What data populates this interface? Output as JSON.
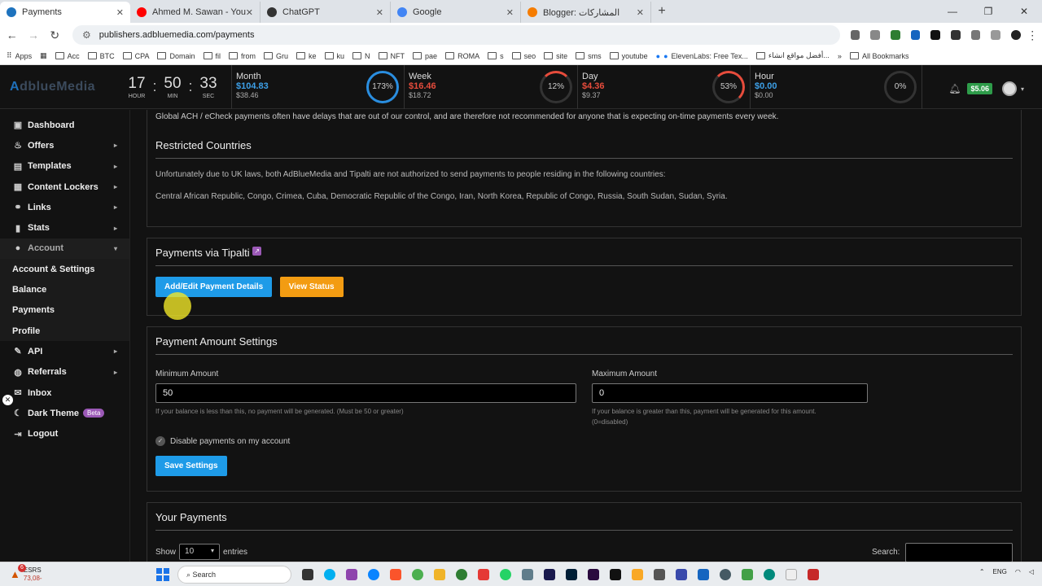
{
  "browser": {
    "tabs": [
      {
        "title": "Payments",
        "color": "#1e73be",
        "active": true
      },
      {
        "title": "Ahmed M. Sawan - YouTube",
        "color": "#ff0000",
        "active": false
      },
      {
        "title": "ChatGPT",
        "color": "#333333",
        "active": false
      },
      {
        "title": "Google",
        "color": "#4285f4",
        "active": false
      },
      {
        "title": "Blogger: المشاركات",
        "color": "#f57c00",
        "active": false
      }
    ],
    "new_tab": "+",
    "url": "publishers.adbluemedia.com/payments",
    "bookmarks": [
      "Apps",
      "Acc",
      "BTC",
      "CPA",
      "Domain",
      "fil",
      "from",
      "Gru",
      "ke",
      "ku",
      "N",
      "NFT",
      "pae",
      "ROMA",
      "s",
      "seo",
      "site",
      "sms",
      "youtube",
      "ElevenLabs: Free Tex...",
      "أفضل مواقع انشاء...",
      "All Bookmarks"
    ]
  },
  "header": {
    "logo_prefix": "A",
    "logo_rest": "dblueMedia",
    "timer": [
      {
        "value": "17",
        "label": "HOUR"
      },
      {
        "value": "50",
        "label": "MIN"
      },
      {
        "value": "33",
        "label": "SEC"
      }
    ],
    "timer_sep": ":",
    "stats": [
      {
        "title": "Month",
        "value": "$104.83",
        "prev": "$38.46",
        "percent": "173%",
        "value_color": "#3da0e8",
        "ring_color": "#2a8ee0"
      },
      {
        "title": "Week",
        "value": "$16.46",
        "prev": "$18.72",
        "percent": "12%",
        "value_color": "#e74c3c",
        "ring_color": "#e74c3c"
      },
      {
        "title": "Day",
        "value": "$4.36",
        "prev": "$9.37",
        "percent": "53%",
        "value_color": "#e74c3c",
        "ring_color": "#e74c3c"
      },
      {
        "title": "Hour",
        "value": "$0.00",
        "prev": "$0.00",
        "percent": "0%",
        "value_color": "#3da0e8",
        "ring_color": "#333333"
      }
    ],
    "balance": "$5.06"
  },
  "sidebar": {
    "items": [
      {
        "label": "Dashboard",
        "icon": "dashboard-icon",
        "glyph": "▣",
        "arrow": ""
      },
      {
        "label": "Offers",
        "icon": "fire-icon",
        "glyph": "♨",
        "arrow": "▸"
      },
      {
        "label": "Templates",
        "icon": "template-icon",
        "glyph": "▤",
        "arrow": "▸"
      },
      {
        "label": "Content Lockers",
        "icon": "locker-icon",
        "glyph": "▦",
        "arrow": "▸"
      },
      {
        "label": "Links",
        "icon": "link-icon",
        "glyph": "⚭",
        "arrow": "▸"
      },
      {
        "label": "Stats",
        "icon": "stats-icon",
        "glyph": "▮",
        "arrow": "▸"
      }
    ],
    "account": {
      "label": "Account",
      "glyph": "●",
      "arrow": "▾"
    },
    "sub_items": [
      "Account & Settings",
      "Balance",
      "Payments",
      "Profile"
    ],
    "bottom": [
      {
        "label": "API",
        "icon": "wrench-icon",
        "glyph": "✎",
        "arrow": "▸"
      },
      {
        "label": "Referrals",
        "icon": "globe-icon",
        "glyph": "◍",
        "arrow": "▸"
      },
      {
        "label": "Inbox",
        "icon": "mail-icon",
        "glyph": "✉",
        "arrow": ""
      }
    ],
    "dark_theme": "Dark Theme",
    "beta": "Beta",
    "logout": "Logout"
  },
  "main": {
    "ach_note": "Global ACH / eCheck payments often have delays that are out of our control, and are therefore not recommended for anyone that is expecting on-time payments every week.",
    "restricted": {
      "title": "Restricted Countries",
      "text": "Unfortunately due to UK laws, both AdBlueMedia and Tipalti are not authorized to send payments to people residing in the following countries:",
      "countries": "Central African Republic, Congo, Crimea, Cuba, Democratic Republic of the Congo, Iran, North Korea, Republic of Congo, Russia, South Sudan, Sudan, Syria."
    },
    "tipalti": {
      "title": "Payments via Tipalti",
      "add_button": "Add/Edit Payment Details",
      "status_button": "View Status"
    },
    "amount_settings": {
      "title": "Payment Amount Settings",
      "min_label": "Minimum Amount",
      "min_value": "50",
      "min_help": "If your balance is less than this, no payment will be generated. (Must be 50 or greater)",
      "max_label": "Maximum Amount",
      "max_value": "0",
      "max_help_1": "If your balance is greater than this, payment will be generated for this amount.",
      "max_help_2": "(0=disabled)",
      "disable_label": "Disable payments on my account",
      "save_button": "Save Settings"
    },
    "your_payments": {
      "title": "Your Payments",
      "show": "Show",
      "entries_value": "10",
      "entries": "entries",
      "search": "Search:"
    }
  },
  "taskbar": {
    "weather_name": "ESRS",
    "weather_value": "73,08-",
    "badge": "6",
    "search": "Search",
    "lang": "ENG"
  }
}
